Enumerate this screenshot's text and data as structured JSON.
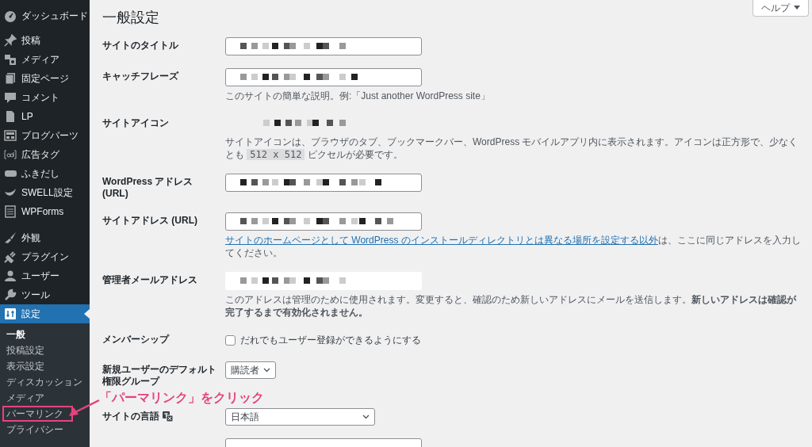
{
  "sidebar": {
    "groups": [
      [
        {
          "label": "ダッシュボード",
          "selected": false
        }
      ],
      [
        {
          "label": "投稿",
          "selected": false
        },
        {
          "label": "メディア",
          "selected": false
        },
        {
          "label": "固定ページ",
          "selected": false
        },
        {
          "label": "コメント",
          "selected": false
        },
        {
          "label": "LP",
          "selected": false
        },
        {
          "label": "ブログパーツ",
          "selected": false
        },
        {
          "label": "広告タグ",
          "selected": false
        },
        {
          "label": "ふきだし",
          "selected": false
        },
        {
          "label": "SWELL設定",
          "selected": false
        },
        {
          "label": "WPForms",
          "selected": false
        }
      ],
      [
        {
          "label": "外観",
          "selected": false
        },
        {
          "label": "プラグイン",
          "selected": false
        },
        {
          "label": "ユーザー",
          "selected": false
        },
        {
          "label": "ツール",
          "selected": false
        },
        {
          "label": "設定",
          "selected": true
        }
      ]
    ],
    "submenu": [
      {
        "label": "一般",
        "selected": true,
        "highlighted": false
      },
      {
        "label": "投稿設定",
        "selected": false,
        "highlighted": false
      },
      {
        "label": "表示設定",
        "selected": false,
        "highlighted": false
      },
      {
        "label": "ディスカッション",
        "selected": false,
        "highlighted": false
      },
      {
        "label": "メディア",
        "selected": false,
        "highlighted": false
      },
      {
        "label": "パーマリンク",
        "selected": false,
        "highlighted": true
      },
      {
        "label": "プライバシー",
        "selected": false,
        "highlighted": false
      }
    ]
  },
  "help_button": {
    "label": "ヘルプ"
  },
  "page_title": "一般設定",
  "settings": [
    {
      "kind": "text",
      "label": "サイトのタイトル",
      "redacted": true
    },
    {
      "kind": "text",
      "label": "キャッチフレーズ",
      "redacted": true,
      "description": [
        {
          "kind": "plain",
          "text": "このサイトの簡単な説明。例:「Just another WordPress site」"
        }
      ]
    },
    {
      "kind": "icon",
      "label": "サイトアイコン",
      "redacted": true,
      "description": [
        {
          "kind": "plain",
          "text": "サイトアイコンは、ブラウザのタブ、ブックマークバー、WordPress モバイルアプリ内に表示されます。アイコンは正方形で、少なくとも "
        },
        {
          "kind": "code",
          "text": "512 x 512"
        },
        {
          "kind": "plain",
          "text": " ピクセルが必要です。"
        }
      ]
    },
    {
      "kind": "text",
      "label": "WordPress アドレス (URL)",
      "redacted": true
    },
    {
      "kind": "text",
      "label": "サイトアドレス (URL)",
      "redacted": true,
      "description": [
        {
          "kind": "link",
          "text": "サイトのホームページとして WordPress のインストールディレクトリとは異なる場所を設定する以外"
        },
        {
          "kind": "plain",
          "text": "は、ここに同じアドレスを入力してください。"
        }
      ]
    },
    {
      "kind": "email",
      "label": "管理者メールアドレス",
      "redacted": true,
      "description": [
        {
          "kind": "plain",
          "text": "このアドレスは管理のために使用されます。変更すると、確認のため新しいアドレスにメールを送信します。**新しいアドレスは確認が完了するまで有効化されません。**"
        }
      ]
    },
    {
      "kind": "checkbox",
      "label": "メンバーシップ",
      "option": "だれでもユーザー登録ができるようにする",
      "checked": false
    },
    {
      "kind": "compact-select",
      "label": "新規ユーザーのデフォルト権限グループ",
      "value": "購読者"
    },
    {
      "kind": "select",
      "label": "サイトの言語",
      "value": "日本語",
      "translate_icon": true
    },
    {
      "kind": "text"
    }
  ],
  "annotation": {
    "text": "「パーマリンク」をクリック"
  }
}
